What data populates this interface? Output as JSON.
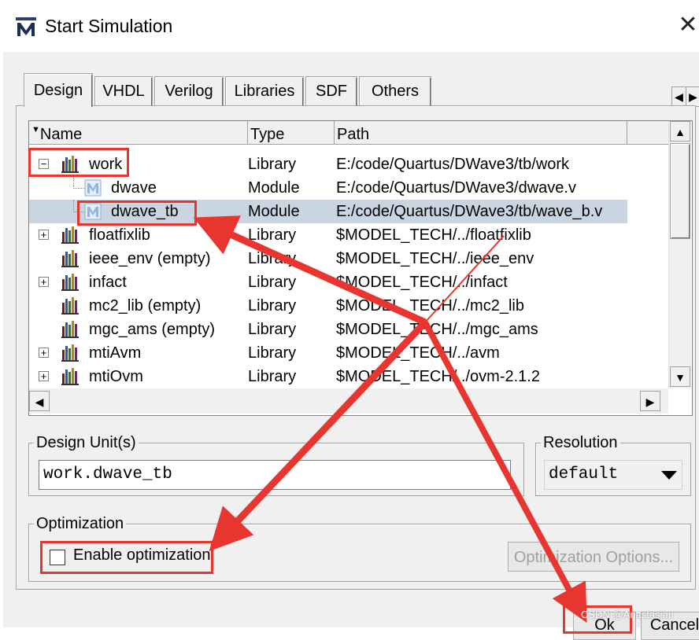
{
  "window": {
    "title": "Start Simulation",
    "close_glyph": "✕"
  },
  "tabs": [
    {
      "label": "Design",
      "active": true
    },
    {
      "label": "VHDL",
      "active": false
    },
    {
      "label": "Verilog",
      "active": false
    },
    {
      "label": "Libraries",
      "active": false
    },
    {
      "label": "SDF",
      "active": false
    },
    {
      "label": "Others",
      "active": false
    }
  ],
  "tab_scroll": {
    "left": "◀",
    "right": "▶"
  },
  "tree": {
    "columns": {
      "sort_glyph": "▼",
      "name": "Name",
      "type": "Type",
      "path": "Path"
    },
    "rows": [
      {
        "name": "work",
        "type": "Library",
        "path": "E:/code/Quartus/DWave3/tb/work",
        "expander": "−",
        "icon": "library-icon"
      },
      {
        "name": "dwave",
        "type": "Module",
        "path": "E:/code/Quartus/DWave3/dwave.v",
        "expander": "",
        "icon": "module-icon"
      },
      {
        "name": "dwave_tb",
        "type": "Module",
        "path": "E:/code/Quartus/DWave3/tb/wave_b.v",
        "expander": "",
        "icon": "module-icon",
        "selected": true
      },
      {
        "name": "floatfixlib",
        "type": "Library",
        "path": "$MODEL_TECH/../floatfixlib",
        "expander": "+",
        "icon": "library-icon"
      },
      {
        "name": "ieee_env  (empty)",
        "type": "Library",
        "path": "$MODEL_TECH/../ieee_env",
        "expander": "",
        "icon": "library-icon"
      },
      {
        "name": "infact",
        "type": "Library",
        "path": "$MODEL_TECH/../infact",
        "expander": "+",
        "icon": "library-icon"
      },
      {
        "name": "mc2_lib  (empty)",
        "type": "Library",
        "path": "$MODEL_TECH/../mc2_lib",
        "expander": "",
        "icon": "library-icon"
      },
      {
        "name": "mgc_ams  (empty)",
        "type": "Library",
        "path": "$MODEL_TECH/../mgc_ams",
        "expander": "",
        "icon": "library-icon"
      },
      {
        "name": "mtiAvm",
        "type": "Library",
        "path": "$MODEL_TECH/../avm",
        "expander": "+",
        "icon": "library-icon"
      },
      {
        "name": "mtiOvm",
        "type": "Library",
        "path": "$MODEL_TECH/../ovm-2.1.2",
        "expander": "+",
        "icon": "library-icon"
      }
    ],
    "scroll": {
      "up": "▲",
      "down": "▼",
      "left": "◀",
      "right": "▶"
    }
  },
  "design_units": {
    "label": "Design Unit(s)",
    "value": "work.dwave_tb"
  },
  "resolution": {
    "label": "Resolution",
    "value": "default",
    "arrow": "▼"
  },
  "optimization": {
    "label": "Optimization",
    "enable_label": "Enable optimization",
    "enabled": false,
    "options_button": "Optimization Options..."
  },
  "buttons": {
    "ok": "Ok",
    "cancel": "Cancel"
  },
  "watermark": "CSDN @Anastasiaıı",
  "colors": {
    "annotation": "#e8352f",
    "selected_row": "#c9d6e2",
    "dialog_bg": "#f0f0f0"
  }
}
